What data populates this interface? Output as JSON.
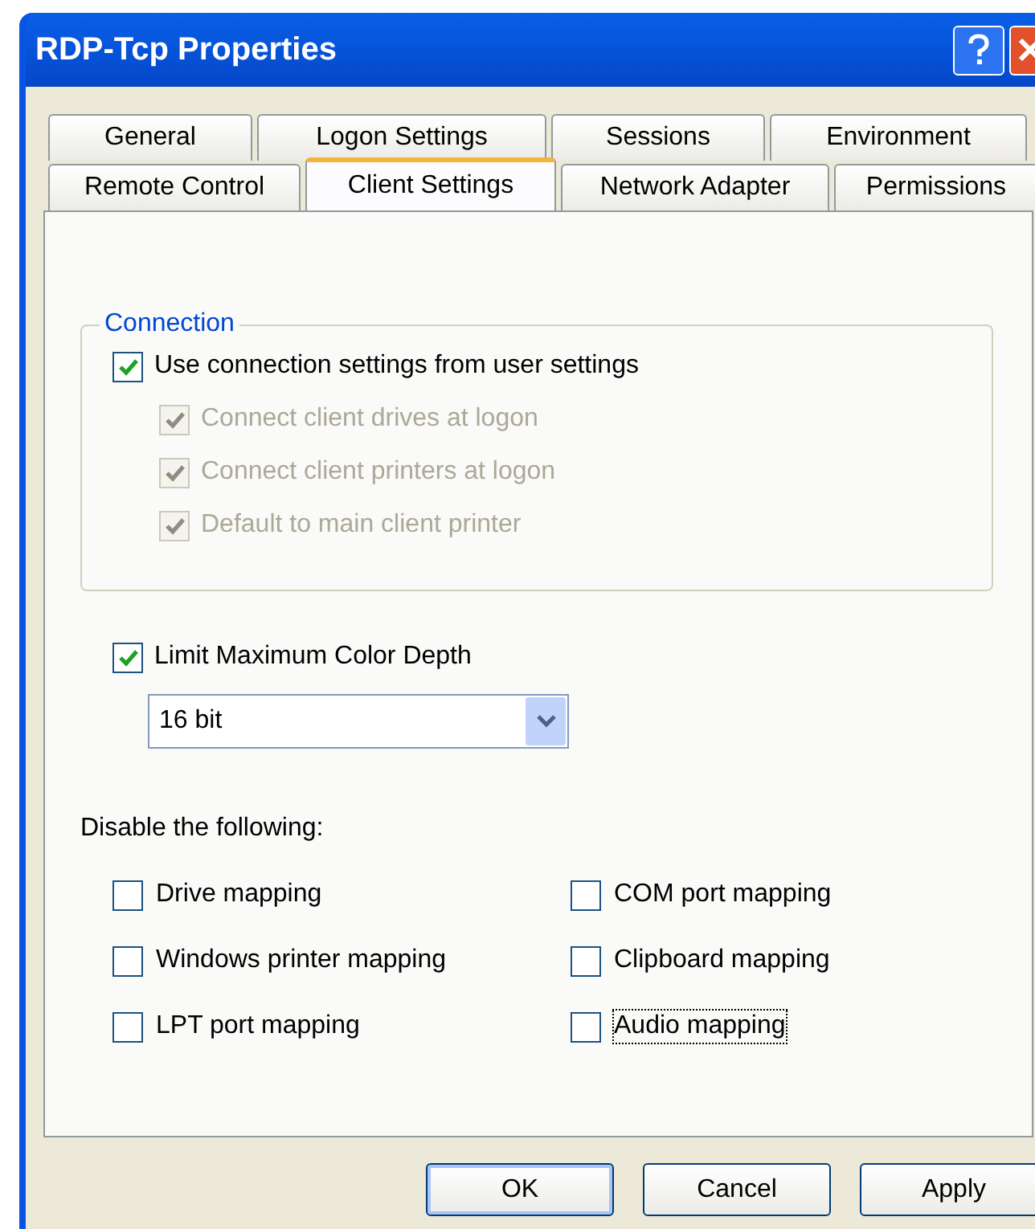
{
  "window": {
    "title": "RDP-Tcp Properties"
  },
  "tab_rows": [
    [
      {
        "label": "General",
        "selected": false
      },
      {
        "label": "Logon Settings",
        "selected": false
      },
      {
        "label": "Sessions",
        "selected": false
      },
      {
        "label": "Environment",
        "selected": false
      }
    ],
    [
      {
        "label": "Remote Control",
        "selected": false
      },
      {
        "label": "Client Settings",
        "selected": true
      },
      {
        "label": "Network Adapter",
        "selected": false
      },
      {
        "label": "Permissions",
        "selected": false
      }
    ]
  ],
  "connection": {
    "legend": "Connection",
    "main": {
      "label": "Use connection settings from user settings",
      "checked": true,
      "disabled": false
    },
    "options": [
      {
        "label": "Connect client drives at logon",
        "checked": true,
        "disabled": true
      },
      {
        "label": "Connect client printers at logon",
        "checked": true,
        "disabled": true
      },
      {
        "label": "Default to main client printer",
        "checked": true,
        "disabled": true
      }
    ]
  },
  "color_depth": {
    "label": "Limit Maximum Color Depth",
    "checked": true,
    "disabled": false,
    "value": "16 bit"
  },
  "disable": {
    "heading": "Disable the following:",
    "items": [
      {
        "label": "Drive mapping",
        "checked": false,
        "focused": false
      },
      {
        "label": "COM port mapping",
        "checked": false,
        "focused": false
      },
      {
        "label": "Windows printer mapping",
        "checked": false,
        "focused": false
      },
      {
        "label": "Clipboard mapping",
        "checked": false,
        "focused": false
      },
      {
        "label": "LPT port mapping",
        "checked": false,
        "focused": false
      },
      {
        "label": "Audio mapping",
        "checked": false,
        "focused": true
      }
    ]
  },
  "buttons": [
    {
      "label": "OK",
      "default": true
    },
    {
      "label": "Cancel",
      "default": false
    },
    {
      "label": "Apply",
      "default": false
    }
  ]
}
